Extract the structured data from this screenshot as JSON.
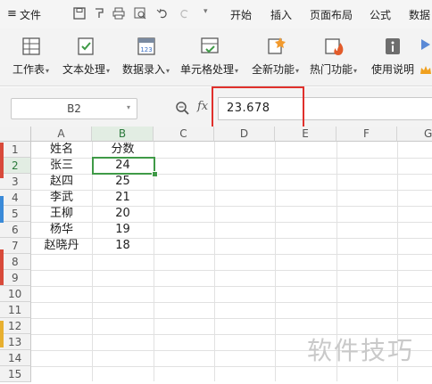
{
  "menu": {
    "file_label": "文件",
    "tabs": [
      "开始",
      "插入",
      "页面布局",
      "公式",
      "数据"
    ]
  },
  "ribbon": {
    "items": [
      {
        "label": "工作表",
        "icon": "worksheet-icon"
      },
      {
        "label": "文本处理",
        "icon": "text-process-icon"
      },
      {
        "label": "数据录入",
        "icon": "data-entry-icon"
      },
      {
        "label": "单元格处理",
        "icon": "cell-process-icon"
      },
      {
        "label": "全新功能",
        "icon": "new-feature-icon"
      },
      {
        "label": "热门功能",
        "icon": "hot-feature-icon"
      },
      {
        "label": "使用说明",
        "icon": "help-icon"
      }
    ]
  },
  "formula_bar": {
    "name_box": "B2",
    "fx_label": "fx",
    "value": "23.678"
  },
  "sheet": {
    "columns": [
      "A",
      "B",
      "C",
      "D",
      "E",
      "F",
      "G"
    ],
    "rows": [
      "1",
      "2",
      "3",
      "4",
      "5",
      "6",
      "7",
      "8",
      "9",
      "10",
      "11",
      "12",
      "13",
      "14",
      "15"
    ],
    "selected_cell": "B2",
    "header": {
      "name": "姓名",
      "score": "分数"
    },
    "data": [
      {
        "name": "张三",
        "score": "24"
      },
      {
        "name": "赵四",
        "score": "25"
      },
      {
        "name": "李武",
        "score": "21"
      },
      {
        "name": "王柳",
        "score": "20"
      },
      {
        "name": "杨华",
        "score": "19"
      },
      {
        "name": "赵晓丹",
        "score": "18"
      }
    ]
  },
  "watermark": "软件技巧",
  "colors": {
    "highlight": "#e0302c",
    "selection": "#3f9a47"
  }
}
